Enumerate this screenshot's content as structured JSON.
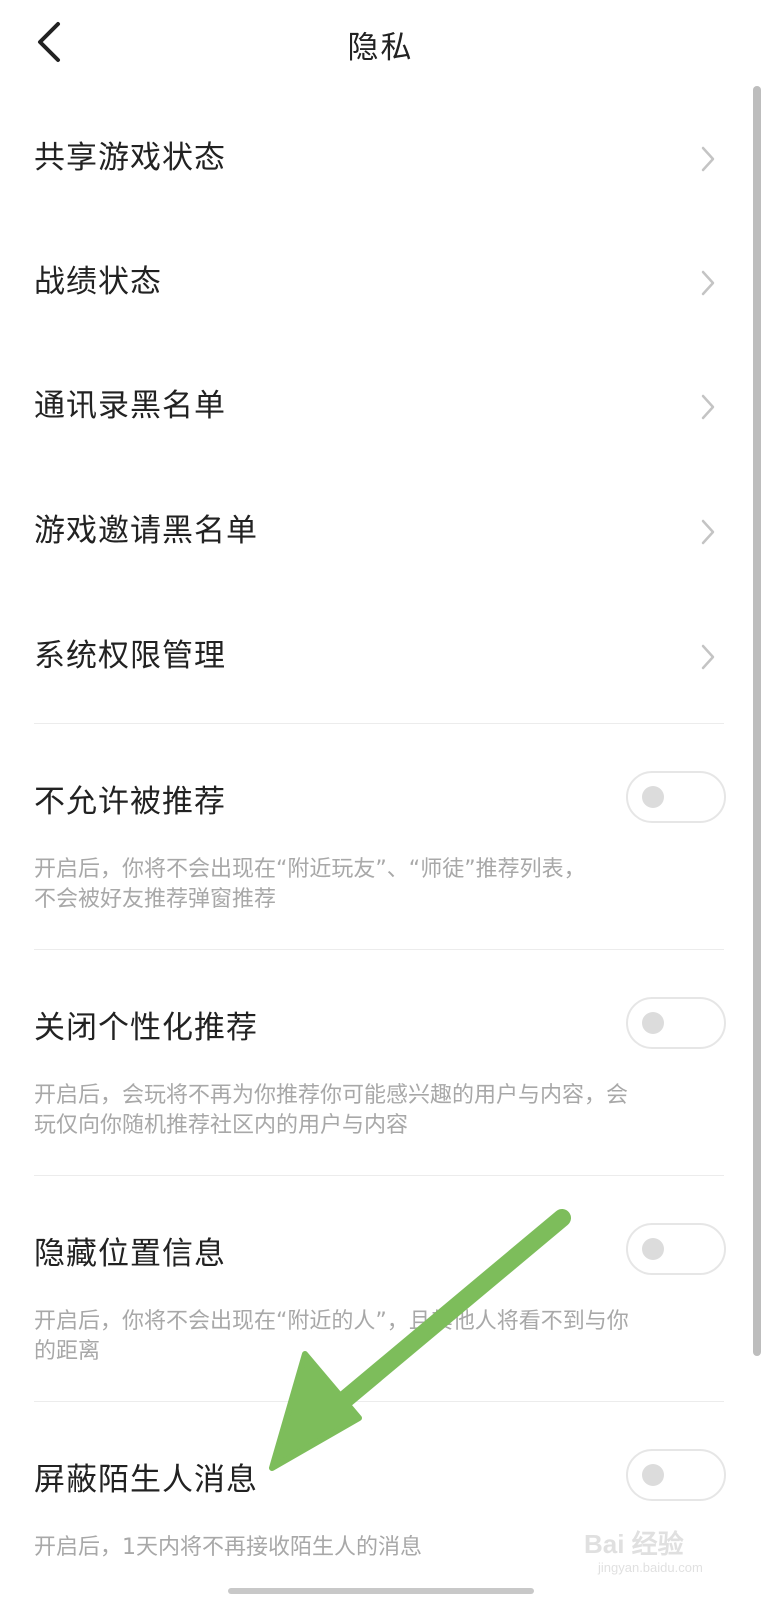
{
  "header": {
    "title": "隐私",
    "back_icon": "chevron-left-icon"
  },
  "nav_items": [
    {
      "label": "共享游戏状态",
      "icon": "chevron-right-icon"
    },
    {
      "label": "战绩状态",
      "icon": "chevron-right-icon"
    },
    {
      "label": "通讯录黑名单",
      "icon": "chevron-right-icon"
    },
    {
      "label": "游戏邀请黑名单",
      "icon": "chevron-right-icon"
    },
    {
      "label": "系统权限管理",
      "icon": "chevron-right-icon"
    }
  ],
  "toggle_items": [
    {
      "label": "不允许被推荐",
      "desc_line1": "开启后，你将不会出现在“附近玩友”、“师徒”推荐列表，",
      "desc_line2": "不会被好友推荐弹窗推荐",
      "enabled": false
    },
    {
      "label": "关闭个性化推荐",
      "desc_line1": "开启后，会玩将不再为你推荐你可能感兴趣的用户与内容，会",
      "desc_line2": "玩仅向你随机推荐社区内的用户与内容",
      "enabled": false
    },
    {
      "label": "隐藏位置信息",
      "desc_line1": "开启后，你将不会出现在“附近的人”，且其他人将看不到与你",
      "desc_line2": "的距离",
      "enabled": false
    },
    {
      "label": "屏蔽陌生人消息",
      "desc_line1": "开启后，1天内将不再接收陌生人的消息",
      "desc_line2": "",
      "enabled": false
    }
  ],
  "annotation": {
    "color": "#7dbd5b",
    "icon": "arrow-icon"
  },
  "watermark": {
    "logo": "Bai 经验",
    "sub": "jingyan.baidu.com"
  },
  "colors": {
    "text_primary": "#222222",
    "text_secondary": "#a8a8a8",
    "divider": "#ececec",
    "toggle_border": "#e6e6e6",
    "toggle_knob": "#dcdcdc"
  }
}
